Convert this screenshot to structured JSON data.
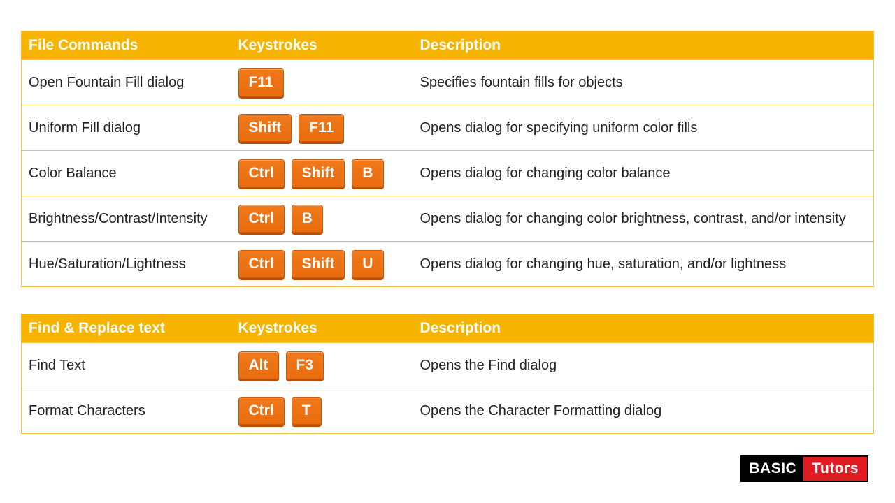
{
  "tables": [
    {
      "headers": [
        "File Commands",
        "Keystrokes",
        "Description"
      ],
      "rows": [
        {
          "cmd": "Open Fountain Fill dialog",
          "keys": [
            "F11"
          ],
          "desc": "Specifies fountain fills for objects"
        },
        {
          "cmd": "Uniform Fill dialog",
          "keys": [
            "Shift",
            "F11"
          ],
          "desc": "Opens dialog for specifying uniform color fills"
        },
        {
          "cmd": "Color Balance",
          "keys": [
            "Ctrl",
            "Shift",
            "B"
          ],
          "desc": "Opens dialog for changing color balance"
        },
        {
          "cmd": "Brightness/Contrast/Intensity",
          "keys": [
            "Ctrl",
            "B"
          ],
          "desc": "Opens dialog for changing color brightness, contrast, and/or intensity"
        },
        {
          "cmd": "Hue/Saturation/Lightness",
          "keys": [
            "Ctrl",
            "Shift",
            "U"
          ],
          "desc": "Opens dialog for changing hue, saturation, and/or lightness"
        }
      ]
    },
    {
      "headers": [
        "Find & Replace text",
        "Keystrokes",
        "Description"
      ],
      "rows": [
        {
          "cmd": "Find Text",
          "keys": [
            "Alt",
            "F3"
          ],
          "desc": "Opens the Find dialog"
        },
        {
          "cmd": "Format Characters",
          "keys": [
            "Ctrl",
            "T"
          ],
          "desc": "Opens the Character Formatting dialog"
        }
      ]
    }
  ],
  "logo": {
    "a": "BASIC",
    "b": "Tutors"
  }
}
